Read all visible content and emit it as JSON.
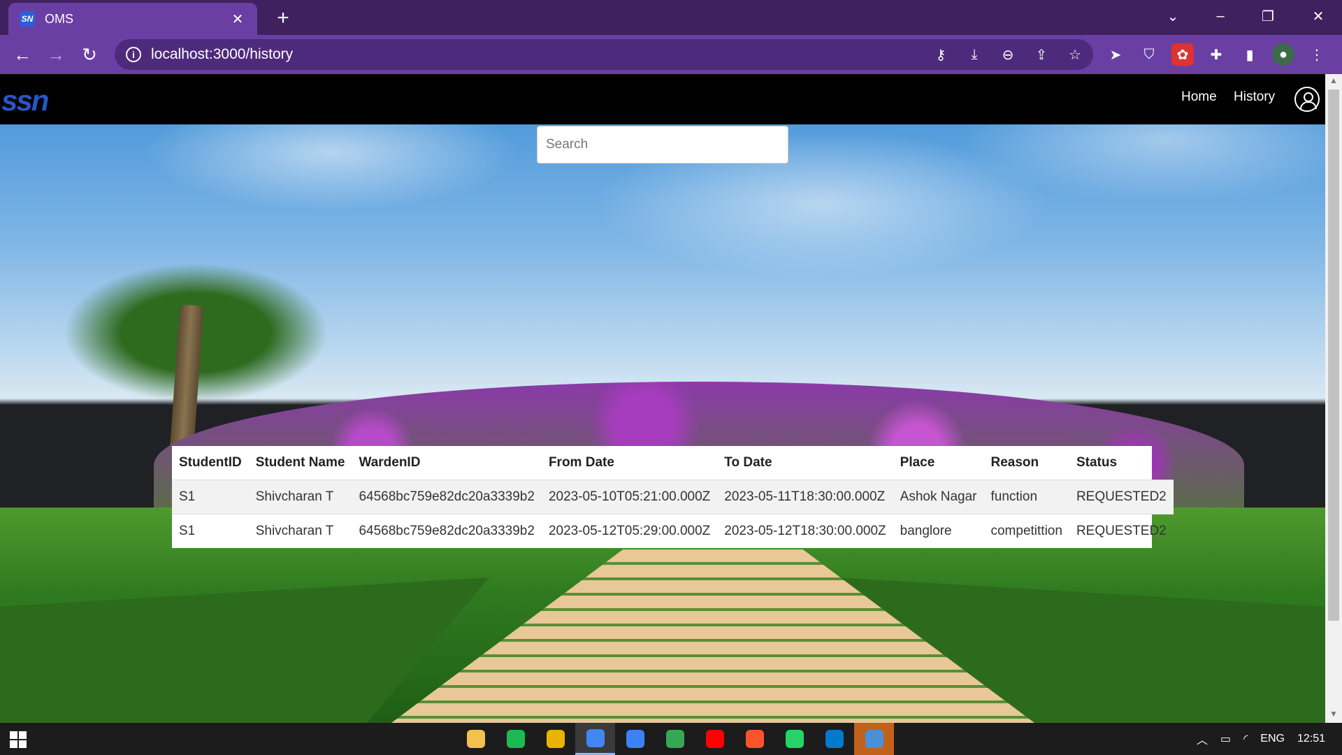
{
  "browser": {
    "tab_title": "OMS",
    "tab_favicon_text": "SN",
    "url": "localhost:3000/history",
    "window_controls": [
      "chevron-down-icon",
      "minimize-icon",
      "restore-icon",
      "close-icon"
    ],
    "omnibox_icons": [
      "key-icon",
      "install-icon",
      "zoom-out-icon",
      "share-icon",
      "star-icon"
    ],
    "extension_icons": [
      "cursor-icon",
      "ublock-icon",
      "extension-red-icon",
      "puzzle-icon",
      "sidebar-icon",
      "profile-avatar-icon",
      "more-icon"
    ]
  },
  "navbar": {
    "logo_text": "ssn",
    "links": [
      {
        "label": "Home"
      },
      {
        "label": "History"
      }
    ]
  },
  "search": {
    "placeholder": "Search",
    "value": ""
  },
  "table": {
    "headers": [
      "StudentID",
      "Student Name",
      "WardenID",
      "From Date",
      "To Date",
      "Place",
      "Reason",
      "Status"
    ],
    "rows": [
      [
        "S1",
        "Shivcharan T",
        "64568bc759e82dc20a3339b2",
        "2023-05-10T05:21:00.000Z",
        "2023-05-11T18:30:00.000Z",
        "Ashok Nagar",
        "function",
        "REQUESTED2"
      ],
      [
        "S1",
        "Shivcharan T",
        "64568bc759e82dc20a3339b2",
        "2023-05-12T05:29:00.000Z",
        "2023-05-12T18:30:00.000Z",
        "banglore",
        "competittion",
        "REQUESTED2"
      ]
    ]
  },
  "taskbar": {
    "apps": [
      {
        "name": "file-explorer-icon",
        "color": "#f2c14e"
      },
      {
        "name": "spotify-icon",
        "color": "#1db954"
      },
      {
        "name": "app-yellow-icon",
        "color": "#e8b400"
      },
      {
        "name": "chrome-icon",
        "color": "#4285f4",
        "active": true
      },
      {
        "name": "browser-blue-icon",
        "color": "#3b82f6"
      },
      {
        "name": "chrome-alt-icon",
        "color": "#34a853"
      },
      {
        "name": "youtube-icon",
        "color": "#ff0000"
      },
      {
        "name": "brave-icon",
        "color": "#fb542b"
      },
      {
        "name": "whatsapp-icon",
        "color": "#25d366"
      },
      {
        "name": "vscode-icon",
        "color": "#007acc"
      },
      {
        "name": "app-orange-icon",
        "color": "#4a90d9",
        "highlight": true
      }
    ],
    "language": "ENG",
    "time": "12:51"
  }
}
